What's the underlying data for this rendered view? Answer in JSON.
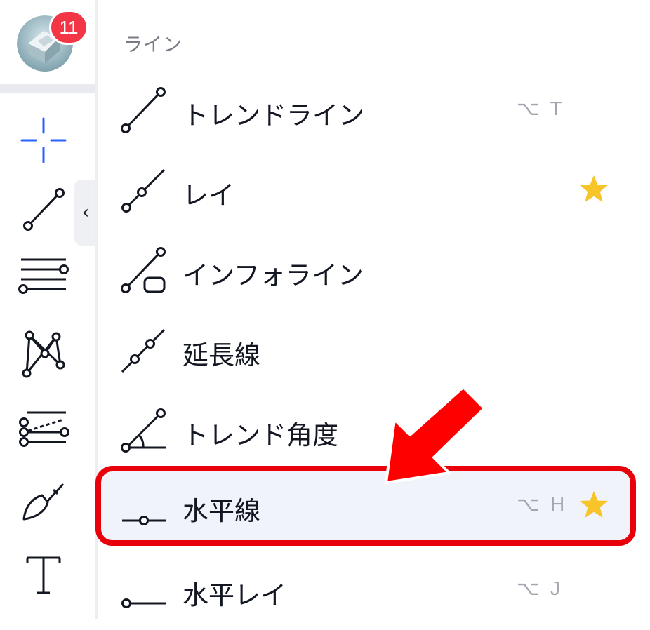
{
  "toolbar": {
    "notification_count": "11",
    "tools": [
      "crosshair-icon",
      "trend-line-icon",
      "horizontal-lines-icon",
      "pattern-icon",
      "fib-icon",
      "brush-icon",
      "text-icon"
    ],
    "collapse_label": "‹"
  },
  "menu": {
    "section_title": "ライン",
    "items": [
      {
        "label": "トレンドライン",
        "shortcut": "⌥ T",
        "starred": false,
        "selected": false,
        "icon": "trend-line-icon"
      },
      {
        "label": "レイ",
        "shortcut": "",
        "starred": true,
        "selected": false,
        "icon": "ray-icon"
      },
      {
        "label": "インフォライン",
        "shortcut": "",
        "starred": false,
        "selected": false,
        "icon": "info-line-icon"
      },
      {
        "label": "延長線",
        "shortcut": "",
        "starred": false,
        "selected": false,
        "icon": "extended-line-icon"
      },
      {
        "label": "トレンド角度",
        "shortcut": "",
        "starred": false,
        "selected": false,
        "icon": "trend-angle-icon"
      },
      {
        "label": "水平線",
        "shortcut": "⌥ H",
        "starred": true,
        "selected": true,
        "icon": "horizontal-line-icon"
      },
      {
        "label": "水平レイ",
        "shortcut": "⌥ J",
        "starred": false,
        "selected": false,
        "icon": "horizontal-ray-icon"
      }
    ]
  },
  "colors": {
    "accent_blue": "#2962ff",
    "star": "#f7c52a",
    "highlight_border": "#e8000b",
    "badge": "#f23645"
  }
}
